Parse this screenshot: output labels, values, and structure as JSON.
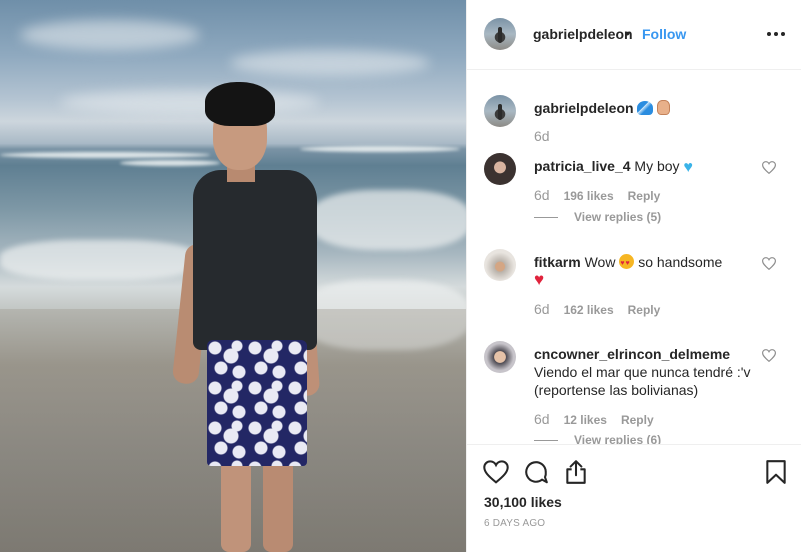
{
  "post": {
    "owner_username": "gabrielpdeleon",
    "separator": "•",
    "follow_label": "Follow",
    "caption_time": "6d",
    "likes_text": "30,100 likes",
    "posted_ago": "6 DAYS AGO"
  },
  "comments": [
    {
      "username": "patricia_live_4",
      "text": "My boy",
      "time": "6d",
      "likes": "196 likes",
      "reply_label": "Reply",
      "view_replies": "View replies (5)"
    },
    {
      "username": "fitkarm",
      "text_before": "Wow",
      "text_after": "so handsome",
      "time": "6d",
      "likes": "162 likes",
      "reply_label": "Reply"
    },
    {
      "username": "cncowner_elrincon_delmeme",
      "text": "Viendo el mar que nunca tendré :'v (reportense las bolivianas)",
      "time": "6d",
      "likes": "12 likes",
      "reply_label": "Reply",
      "view_replies": "View replies (6)"
    }
  ],
  "icons": {
    "more": "more-options-icon",
    "like": "heart-outline-icon",
    "comment": "comment-bubble-icon",
    "share": "share-icon",
    "save": "bookmark-icon"
  },
  "colors": {
    "link": "#3897f0",
    "text": "#262626",
    "muted": "#999999",
    "divider": "#efefef"
  }
}
